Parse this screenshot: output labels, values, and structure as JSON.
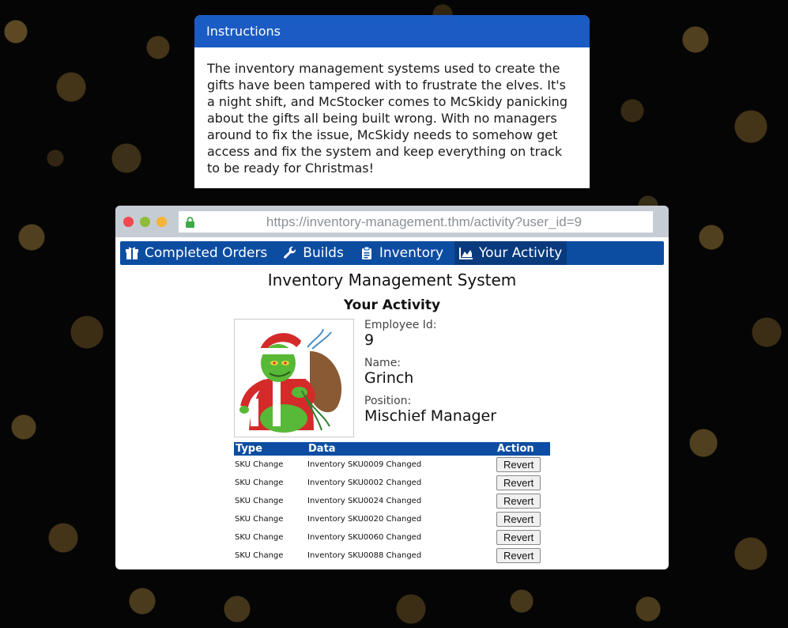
{
  "instructions": {
    "title": "Instructions",
    "body": "The inventory management systems used to create the gifts have been tampered with to frustrate the elves. It's a night shift, and McStocker comes to McSkidy panicking about the gifts all being built wrong. With no managers around to fix the issue, McSkidy needs to somehow get access and fix the system and keep everything on track to be ready for Christmas!"
  },
  "browser": {
    "url": "https://inventory-management.thm/activity?user_id=9"
  },
  "nav": [
    {
      "label": "Completed Orders",
      "icon": "gift-icon"
    },
    {
      "label": "Builds",
      "icon": "wrench-icon"
    },
    {
      "label": "Inventory",
      "icon": "clipboard-icon"
    },
    {
      "label": "Your Activity",
      "icon": "chart-icon",
      "active": true
    }
  ],
  "app": {
    "title": "Inventory Management System",
    "subtitle": "Your Activity"
  },
  "profile": {
    "id_label": "Employee Id:",
    "id_value": "9",
    "name_label": "Name:",
    "name_value": "Grinch",
    "position_label": "Position:",
    "position_value": "Mischief Manager"
  },
  "activity": {
    "headers": [
      "Type",
      "Data",
      "Action"
    ],
    "rows": [
      {
        "type": "SKU Change",
        "data": "Inventory SKU0009 Changed",
        "action": "Revert"
      },
      {
        "type": "SKU Change",
        "data": "Inventory SKU0002 Changed",
        "action": "Revert"
      },
      {
        "type": "SKU Change",
        "data": "Inventory SKU0024 Changed",
        "action": "Revert"
      },
      {
        "type": "SKU Change",
        "data": "Inventory SKU0020 Changed",
        "action": "Revert"
      },
      {
        "type": "SKU Change",
        "data": "Inventory SKU0060 Changed",
        "action": "Revert"
      },
      {
        "type": "SKU Change",
        "data": "Inventory SKU0088 Changed",
        "action": "Revert"
      }
    ]
  }
}
